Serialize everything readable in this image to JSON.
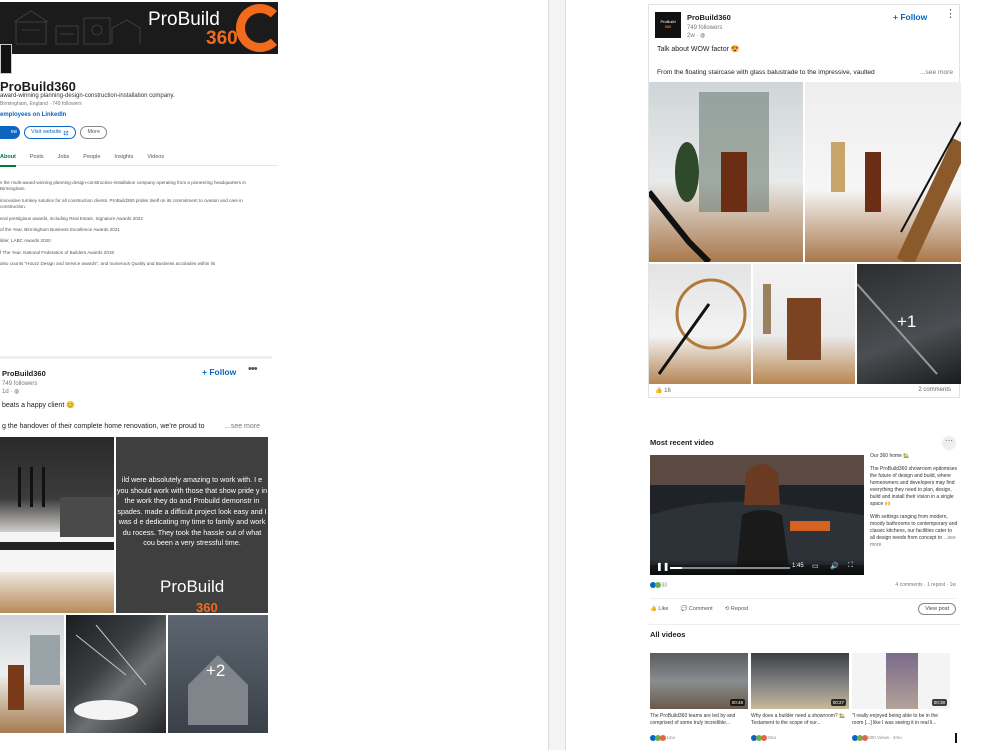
{
  "company": {
    "banner_brand": "ProBuild",
    "banner_num": "360",
    "name": "ProBuild360",
    "tagline": "award-winning planning-design-construction-installation company.",
    "meta": "Birmingham, England · 749 followers",
    "employees": "employees on LinkedIn",
    "follow_label": "ow",
    "visit_label": "Visit website",
    "more_label": "More",
    "tabs": [
      "About",
      "Posts",
      "Jobs",
      "People",
      "Insights",
      "Videos"
    ]
  },
  "about": {
    "heading": "",
    "paragraphs": [
      "s the multi-award-winning planning-design-construction-installation company operating from a pioneering headquarters in Birmingham.",
      "innovative turnkey solution for all construction clients. ProBuild360 prides itself on its commitment to ovation and care in construction.",
      "eral prestigious awards, including Real Estate, Signature Awards 2022",
      "of the Year, Birmingham Business Excellence Awards 2021",
      "ilder, LABC Awards 2020",
      "f The Year, National Federation of Builders Awards 2019",
      "also counts \"Houzz Design and Service awards\", and numerous Quality and Business accolades within its"
    ]
  },
  "post_left": {
    "author": "ProBuild360",
    "followers": "749 followers",
    "time": "1d ·",
    "follow_label": "+ Follow",
    "text1": "beats a happy client 😊",
    "text2": "g the handover of their complete home renovation, we're proud to",
    "see_more": "...see more",
    "quote": "ild were absolutely amazing to work with. I e you should work with those that show pride y in the work they do and Probuild demonstr in spades. made a difficult project look easy and I was d e dedicating my time to family and work du rocess. They took the hassle out of what cou been a very stressful time.",
    "tile_brand": "ProBuild",
    "tile_num": "360",
    "plus_count": "+2"
  },
  "post_right": {
    "logo_text": "ProBuild",
    "logo_num": "360",
    "author": "ProBuild360",
    "followers": "749 followers",
    "time": "2w ·",
    "follow_label": "+ Follow",
    "text1": "Talk about WOW factor 😍",
    "text2": "From the floating staircase with glass balustrade to the impressive, vaulted",
    "see_more": "...see more",
    "plus_count": "+1",
    "reactions": "16",
    "comments": "2 comments"
  },
  "recent_video": {
    "title": "Most recent video",
    "dots": "···",
    "time_label": "1:45",
    "desc_title": "Our 360 home 🏡",
    "desc_p1": "The ProBuild360 showroom epitomises the future of design and build, where homeowners and developers may find everything they need to plan, design, build and install their vision in a single space 🙌",
    "desc_p2": "With settings ranging from modern, moody bathrooms to contemporary and classic kitchens, our facilities cater to all design needs from concept to",
    "see_more": "...see more",
    "reactions": "33",
    "stats": "4 comments · 1 repost · 1w",
    "like": "Like",
    "comment": "Comment",
    "repost": "Repost",
    "view_post": "View post"
  },
  "all_videos": {
    "title": "All videos",
    "items": [
      {
        "duration": "00:48",
        "caption": "The ProBuild360 teams are led by and comprised of some truly incredible...",
        "meta": "1mo"
      },
      {
        "duration": "00:27",
        "caption": "Why does a builder need a showroom? 🏡 Testament to the scope of our...",
        "meta": "2mo"
      },
      {
        "duration": "00:38",
        "caption": "\"I really enjoyed being able to be in the room [...] like I was seeing it in real li...",
        "meta": "500 Views · 4mo"
      }
    ]
  },
  "colors": {
    "accent_orange": "#f26b1d",
    "linkedin_blue": "#0a66c2",
    "active_tab_green": "#057642"
  }
}
